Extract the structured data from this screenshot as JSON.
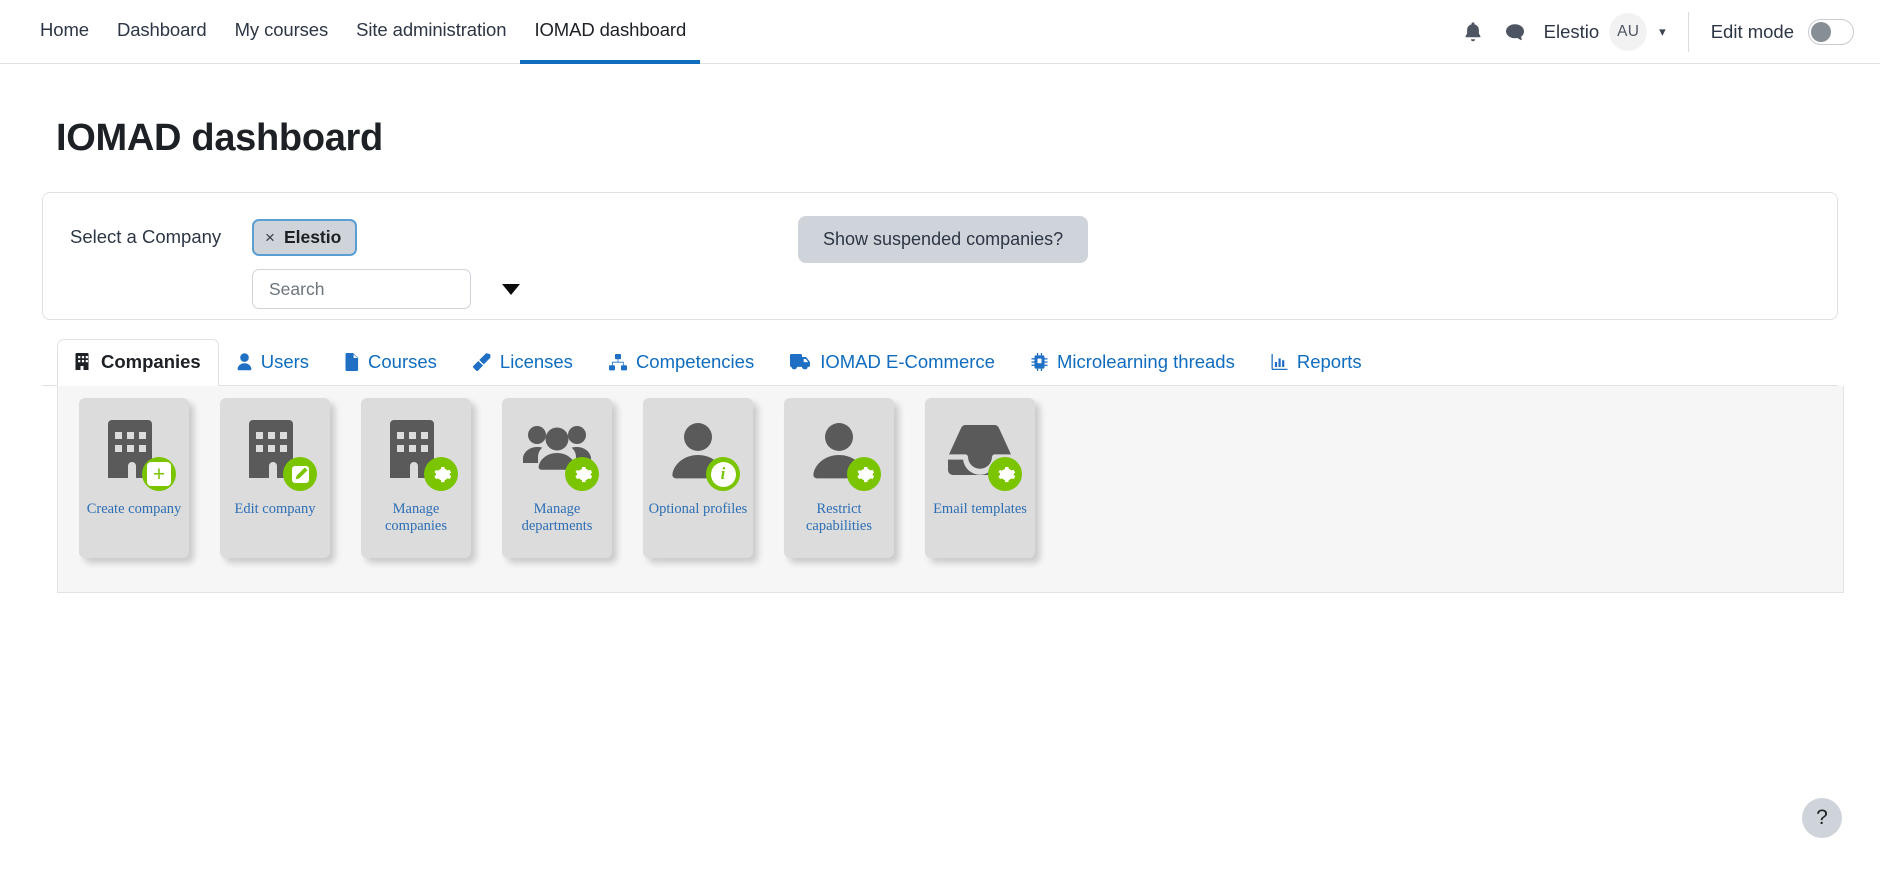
{
  "nav": {
    "items": [
      {
        "label": "Home",
        "active": false
      },
      {
        "label": "Dashboard",
        "active": false
      },
      {
        "label": "My courses",
        "active": false
      },
      {
        "label": "Site administration",
        "active": false
      },
      {
        "label": "IOMAD dashboard",
        "active": true
      }
    ],
    "notifications_icon": "bell-icon",
    "messages_icon": "message-icon",
    "user_name": "Elestio",
    "avatar_initials": "AU",
    "edit_mode_label": "Edit mode",
    "edit_mode_on": false
  },
  "page": {
    "title": "IOMAD dashboard"
  },
  "company_select": {
    "label": "Select a Company",
    "selected_chip": "Elestio",
    "chip_remove_icon": "close-icon",
    "search_value": "",
    "search_placeholder": "Search",
    "dropdown_icon": "caret-down-icon",
    "suspended_button": "Show suspended companies?"
  },
  "tabs": [
    {
      "label": "Companies",
      "icon": "building-icon",
      "active": true
    },
    {
      "label": "Users",
      "icon": "user-icon",
      "active": false
    },
    {
      "label": "Courses",
      "icon": "file-icon",
      "active": false
    },
    {
      "label": "Licenses",
      "icon": "key-icon",
      "active": false
    },
    {
      "label": "Competencies",
      "icon": "sitemap-icon",
      "active": false
    },
    {
      "label": "IOMAD E-Commerce",
      "icon": "truck-icon",
      "active": false
    },
    {
      "label": "Microlearning threads",
      "icon": "microchip-icon",
      "active": false
    },
    {
      "label": "Reports",
      "icon": "chart-bar-icon",
      "active": false
    }
  ],
  "tiles": [
    {
      "label": "Create company",
      "icon": "building-icon",
      "badge": "plus-badge"
    },
    {
      "label": "Edit company",
      "icon": "building-icon",
      "badge": "pencil-badge"
    },
    {
      "label": "Manage companies",
      "icon": "building-icon",
      "badge": "gear-badge"
    },
    {
      "label": "Manage departments",
      "icon": "users-group-icon",
      "badge": "gear-badge"
    },
    {
      "label": "Optional profiles",
      "icon": "user-icon",
      "badge": "info-badge"
    },
    {
      "label": "Restrict capabilities",
      "icon": "user-icon",
      "badge": "gear-badge"
    },
    {
      "label": "Email templates",
      "icon": "inbox-icon",
      "badge": "gear-badge"
    }
  ],
  "help": {
    "label": "?"
  },
  "colors": {
    "accent_blue": "#0f6cbf",
    "link_blue": "#2d6fb5",
    "badge_green": "#7ac400",
    "tile_gray": "#dcdcdc",
    "panel_gray": "#f6f6f6"
  }
}
